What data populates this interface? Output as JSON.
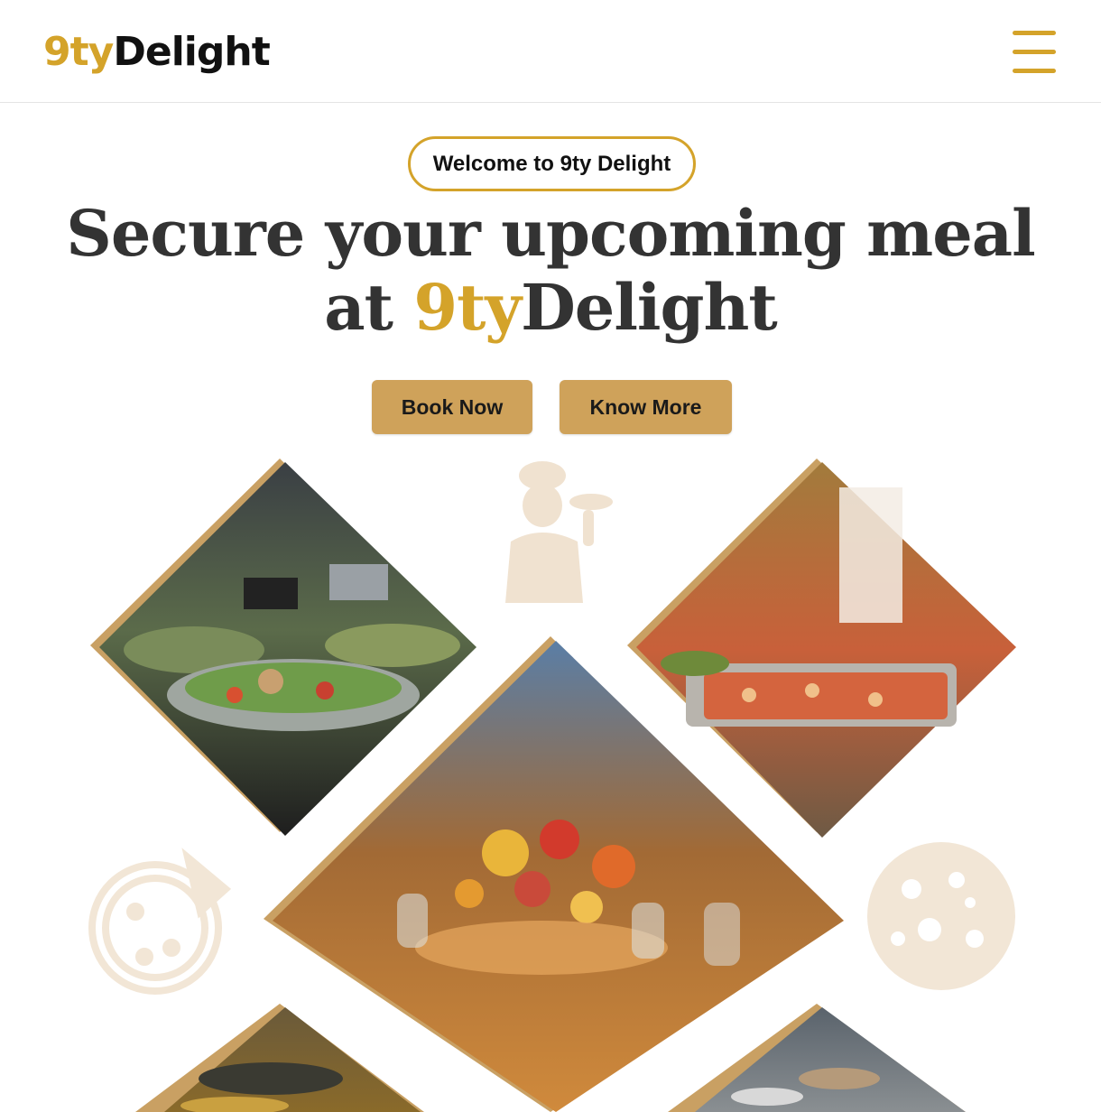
{
  "header": {
    "logo_accent": "9ty",
    "logo_main": "Delight"
  },
  "hero": {
    "welcome_badge": "Welcome to 9ty Delight",
    "headline_line1": "Secure your upcoming meal",
    "headline_prefix": "at ",
    "headline_accent": "9ty",
    "headline_brand": "Delight",
    "book_label": "Book Now",
    "more_label": "Know More"
  },
  "colors": {
    "accent": "#d4a32a",
    "button": "#cfa25a",
    "frame": "#c9a063",
    "silhouette": "#f0e2d0",
    "heading": "#333333"
  },
  "icons": [
    "menu-icon",
    "chef-silhouette-icon",
    "pizza-icon",
    "pizza-outline-icon"
  ]
}
